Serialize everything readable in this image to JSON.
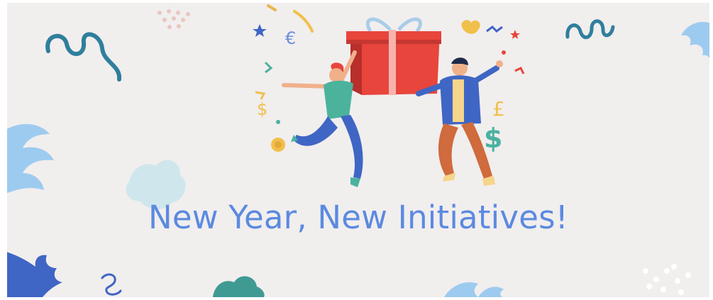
{
  "banner": {
    "headline": "New Year, New Initiatives!",
    "colors": {
      "background": "#f1eeee",
      "headline": "#5b8ae0",
      "gift": "#e8453c",
      "ribbon": "#a9cde8"
    },
    "symbols": {
      "euro": "€",
      "pound": "£",
      "dollar_large": "$",
      "dollar_small": "$"
    },
    "icons": [
      "gift-box-icon",
      "woman-figure-icon",
      "man-figure-icon",
      "star-icon",
      "coin-icon",
      "squiggle-icon",
      "leaf-icon",
      "confetti-icon"
    ]
  }
}
